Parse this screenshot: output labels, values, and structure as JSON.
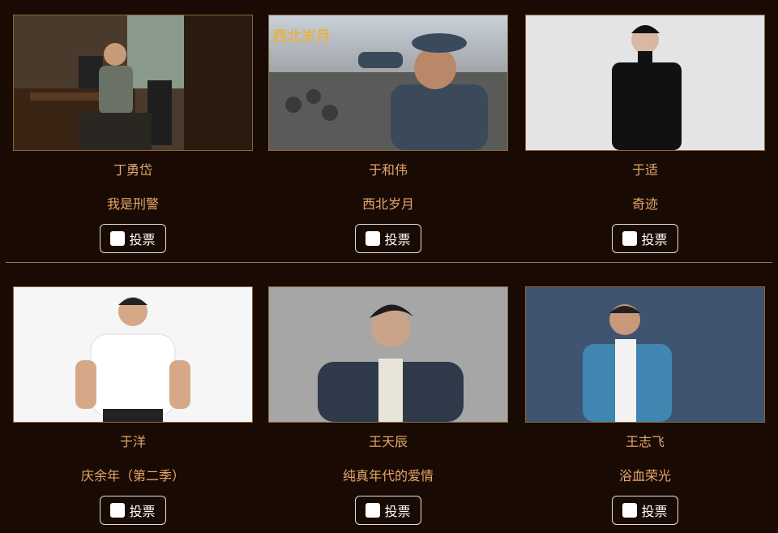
{
  "candidates": [
    {
      "name": "丁勇岱",
      "show": "我是刑警",
      "vote_label": "投票",
      "photo": "actor-at-desk"
    },
    {
      "name": "于和伟",
      "show": "西北岁月",
      "vote_label": "投票",
      "photo": "soldier-saluting",
      "overlay_text": "西北岁月"
    },
    {
      "name": "于适",
      "show": "奇迹",
      "vote_label": "投票",
      "photo": "man-black-coat"
    },
    {
      "name": "于洋",
      "show": "庆余年（第二季）",
      "vote_label": "投票",
      "photo": "man-white-tshirt"
    },
    {
      "name": "王天辰",
      "show": "纯真年代的爱情",
      "vote_label": "投票",
      "photo": "young-man-jacket"
    },
    {
      "name": "王志飞",
      "show": "浴血荣光",
      "vote_label": "投票",
      "photo": "man-blue-coat"
    }
  ],
  "colors": {
    "background": "#1a0a04",
    "accent_text": "#e3a86a",
    "divider": "#9a7b52"
  }
}
